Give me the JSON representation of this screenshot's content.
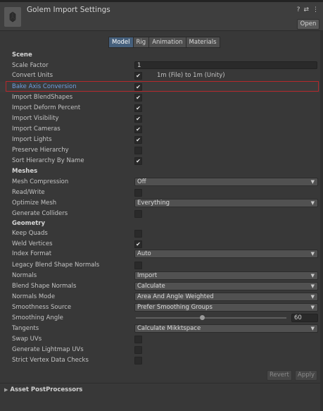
{
  "header": {
    "title": "Golem Import Settings",
    "open_label": "Open",
    "help_icon": "?",
    "preset_icon": "⇄",
    "menu_icon": "⋮"
  },
  "tabs": [
    "Model",
    "Rig",
    "Animation",
    "Materials"
  ],
  "active_tab": "Model",
  "sections": {
    "scene": "Scene",
    "meshes": "Meshes",
    "geometry": "Geometry"
  },
  "fields": {
    "scale_factor": {
      "label": "Scale Factor",
      "value": "1"
    },
    "convert_units": {
      "label": "Convert Units",
      "checked": true,
      "note": "1m (File) to 1m (Unity)"
    },
    "bake_axis_conversion": {
      "label": "Bake Axis Conversion",
      "checked": true
    },
    "import_blendshapes": {
      "label": "Import BlendShapes",
      "checked": true
    },
    "import_deform_percent": {
      "label": "Import Deform Percent",
      "checked": true
    },
    "import_visibility": {
      "label": "Import Visibility",
      "checked": true
    },
    "import_cameras": {
      "label": "Import Cameras",
      "checked": true
    },
    "import_lights": {
      "label": "Import Lights",
      "checked": true
    },
    "preserve_hierarchy": {
      "label": "Preserve Hierarchy",
      "checked": false
    },
    "sort_hierarchy_by_name": {
      "label": "Sort Hierarchy By Name",
      "checked": true
    },
    "mesh_compression": {
      "label": "Mesh Compression",
      "value": "Off"
    },
    "read_write": {
      "label": "Read/Write",
      "checked": false
    },
    "optimize_mesh": {
      "label": "Optimize Mesh",
      "value": "Everything"
    },
    "generate_colliders": {
      "label": "Generate Colliders",
      "checked": false
    },
    "keep_quads": {
      "label": "Keep Quads",
      "checked": false
    },
    "weld_vertices": {
      "label": "Weld Vertices",
      "checked": true
    },
    "index_format": {
      "label": "Index Format",
      "value": "Auto"
    },
    "legacy_blend_shape_normals": {
      "label": "Legacy Blend Shape Normals",
      "checked": false
    },
    "normals": {
      "label": "Normals",
      "value": "Import"
    },
    "blend_shape_normals": {
      "label": "Blend Shape Normals",
      "value": "Calculate"
    },
    "normals_mode": {
      "label": "Normals Mode",
      "value": "Area And Angle Weighted"
    },
    "smoothness_source": {
      "label": "Smoothness Source",
      "value": "Prefer Smoothing Groups"
    },
    "smoothing_angle": {
      "label": "Smoothing Angle",
      "value": "60",
      "fraction": 0.44
    },
    "tangents": {
      "label": "Tangents",
      "value": "Calculate Mikktspace"
    },
    "swap_uvs": {
      "label": "Swap UVs",
      "checked": false
    },
    "generate_lightmap_uvs": {
      "label": "Generate Lightmap UVs",
      "checked": false
    },
    "strict_vertex_data_checks": {
      "label": "Strict Vertex Data Checks",
      "checked": false
    }
  },
  "buttons": {
    "revert": "Revert",
    "apply": "Apply"
  },
  "foldout": {
    "asset_postprocessors": "Asset PostProcessors"
  },
  "colors": {
    "background": "#383838",
    "active_tab": "#46607c",
    "highlight_label": "#6d9ee0",
    "highlight_border": "#b4282c"
  }
}
